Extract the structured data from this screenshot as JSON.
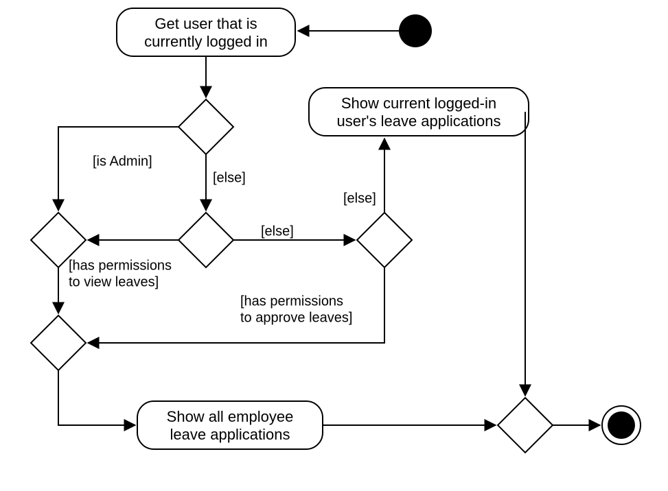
{
  "diagram_type": "UML Activity Diagram",
  "nodes": {
    "action1_line1": "Get user that is",
    "action1_line2": "currently logged in",
    "action2_line1": "Show current logged-in",
    "action2_line2": "user's leave applications",
    "action3_line1": "Show all employee",
    "action3_line2": "leave applications"
  },
  "guards": {
    "isAdmin": "[is Admin]",
    "else1": "[else]",
    "else2": "[else]",
    "else3": "[else]",
    "hasViewLine1": "[has permissions",
    "hasViewLine2": "to view leaves]",
    "hasApproveLine1": "[has permissions",
    "hasApproveLine2": "to approve leaves]"
  }
}
